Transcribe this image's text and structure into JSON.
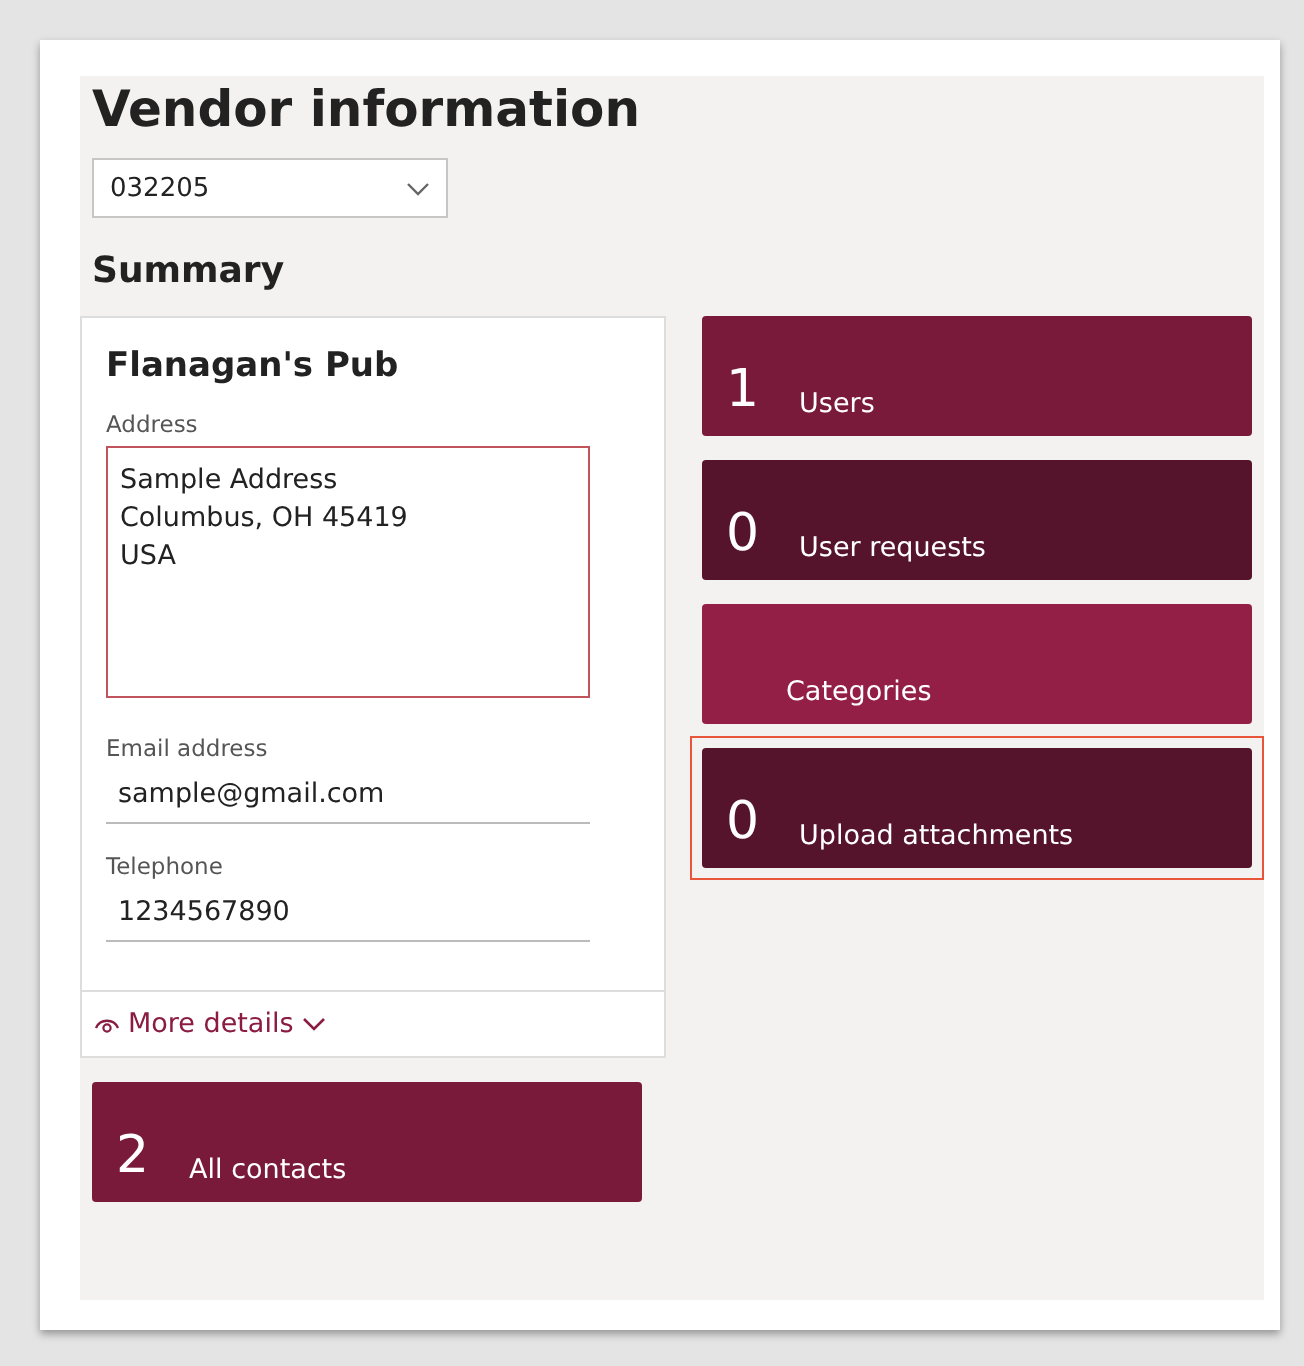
{
  "title": "Vendor information",
  "vendor_select": {
    "value": "032205"
  },
  "summary_heading": "Summary",
  "vendor_card": {
    "name": "Flanagan's Pub",
    "fields": [
      {
        "kind": "multiline",
        "label": "Address",
        "lines": [
          "Sample Address",
          "Columbus, OH 45419",
          "USA"
        ]
      },
      {
        "kind": "line",
        "label": "Email address",
        "value": "sample@gmail.com"
      },
      {
        "kind": "line",
        "label": "Telephone",
        "value": "1234567890"
      }
    ],
    "more_details": {
      "label": "More details",
      "expanded": false
    }
  },
  "contacts_tile": {
    "count": "2",
    "label": "All contacts",
    "color": "#7a1a3a"
  },
  "tiles": [
    {
      "count": "1",
      "label": "Users",
      "color": "#7a1a3a",
      "highlighted": false
    },
    {
      "count": "0",
      "label": "User requests",
      "color": "#55142b",
      "highlighted": false
    },
    {
      "label": "Categories",
      "color": "#931f47",
      "highlighted": false
    },
    {
      "count": "0",
      "label": "Upload attachments",
      "color": "#55142b",
      "highlighted": true
    }
  ]
}
